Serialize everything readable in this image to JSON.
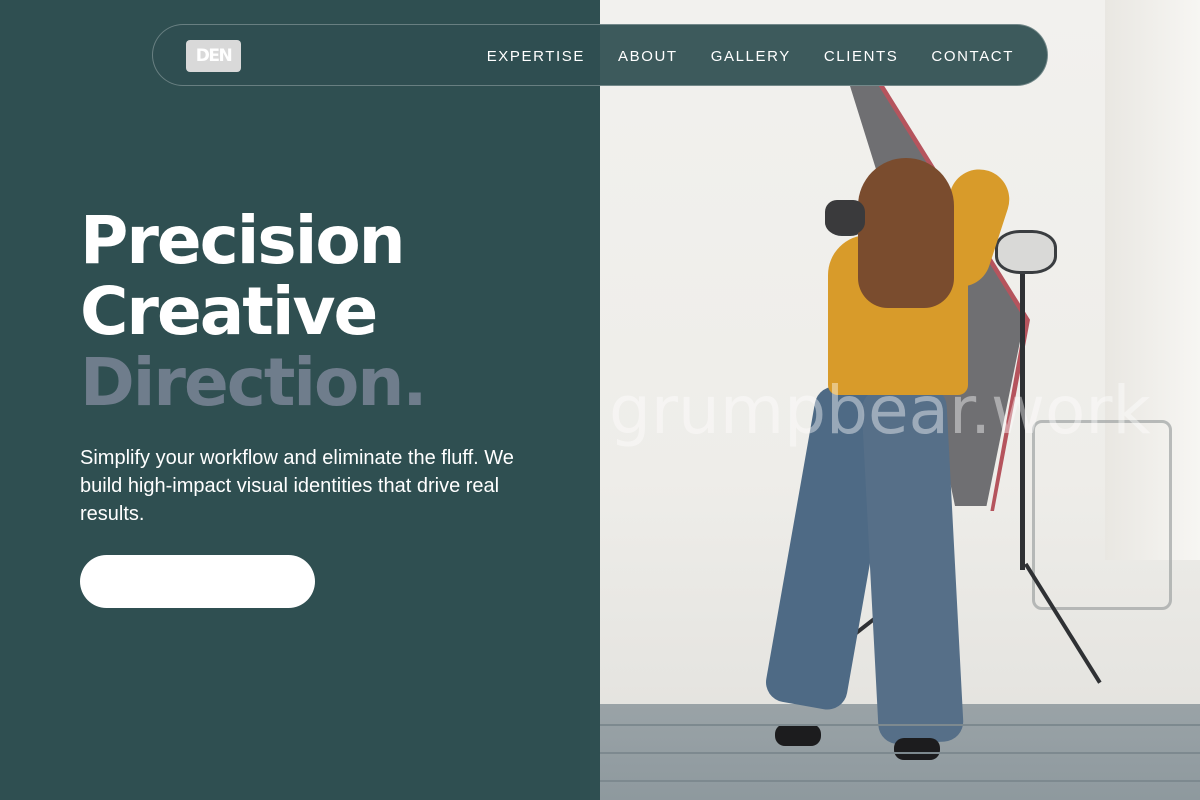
{
  "brand": {
    "logo_text": "DEN"
  },
  "nav": {
    "items": [
      {
        "label": "EXPERTISE"
      },
      {
        "label": "ABOUT"
      },
      {
        "label": "GALLERY"
      },
      {
        "label": "CLIENTS"
      },
      {
        "label": "CONTACT"
      }
    ]
  },
  "hero": {
    "title_line1": "Precision",
    "title_line2": "Creative",
    "title_line3": "Direction",
    "title_dot": ".",
    "subtitle": "Simplify your workflow and eliminate the fluff. We build high-impact visual identities that drive real results.",
    "cta_label": ""
  },
  "photo": {
    "watermark": "grumpbear.work"
  },
  "colors": {
    "panel": "#2f4f51",
    "muted_title": "#6f7d8c",
    "cta": "#ffffff"
  }
}
